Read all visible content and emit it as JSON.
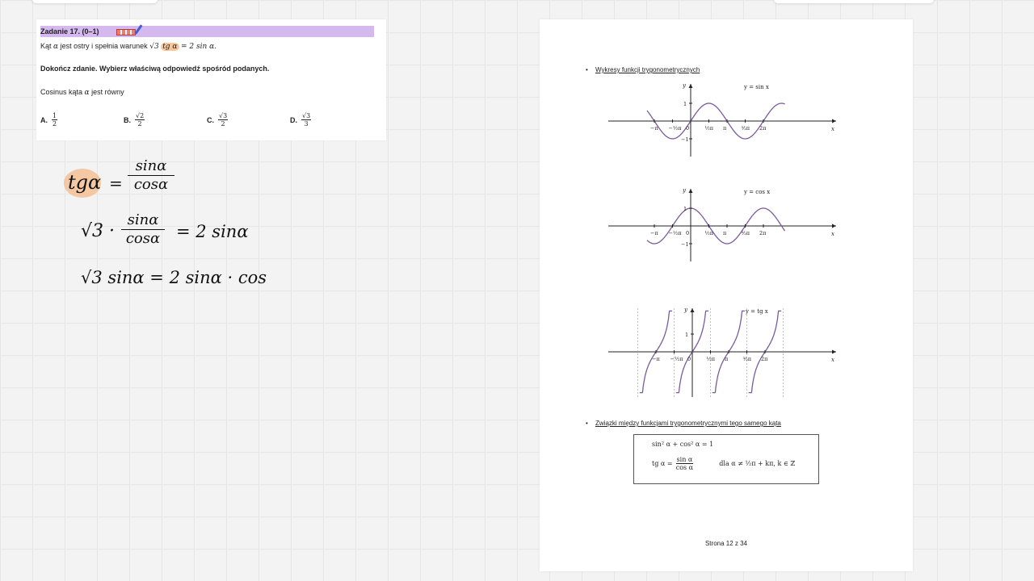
{
  "task": {
    "title": "Zadanie 17. (0–1)",
    "question_prefix": "Kąt",
    "question_alpha": "α",
    "question_mid": "jest ostry i spełnia warunek",
    "question_sqrt3": "√3",
    "question_tg": "tg α",
    "question_rest": "= 2 sin α.",
    "instruction": "Dokończ zdanie. Wybierz właściwą odpowiedź spośród podanych.",
    "cos_prefix": "Cosinus kąta",
    "cos_alpha": "α",
    "cos_suffix": "jest równy",
    "answers": [
      {
        "letter": "A.",
        "num": "1",
        "den": "2"
      },
      {
        "letter": "B.",
        "num": "√2",
        "den": "2"
      },
      {
        "letter": "C.",
        "num": "√3",
        "den": "2"
      },
      {
        "letter": "D.",
        "num": "√3",
        "den": "3"
      }
    ]
  },
  "handwriting": {
    "line1_lhs": "tgα",
    "line1_num": "sinα",
    "line1_den": "cosα",
    "line2_sqrt": "√3 ·",
    "line2_num": "sinα",
    "line2_den": "cosα",
    "line2_rhs": "= 2 sinα",
    "line3": "√3 sinα = 2 sinα · cos"
  },
  "document": {
    "section1_title": "Wykresy funkcji trygonometrycznych",
    "graphs": [
      {
        "label": "y = sin x",
        "function": "sin"
      },
      {
        "label": "y = cos x",
        "function": "cos"
      },
      {
        "label": "y = tg x",
        "function": "tan"
      }
    ],
    "axis_x": "x",
    "axis_y": "y",
    "ticks": {
      "one": "1",
      "minus_one": "−1",
      "zero": "0",
      "minus_pi": "−π",
      "minus_half_pi": "−½π",
      "half_pi": "½π",
      "pi": "π",
      "three_half_pi": "³⁄₂π",
      "two_pi": "2π"
    },
    "section2_title": "Związki między funkcjami trygonometrycznymi tego samego kąta",
    "identity1": "sin² α + cos² α = 1",
    "identity2_lhs": "tg α =",
    "identity2_num": "sin α",
    "identity2_den": "cos α",
    "identity2_cond": "dla  α ≠ ½π + kπ,   k ∈ ℤ",
    "page_number": "Strona 12 z 34"
  }
}
